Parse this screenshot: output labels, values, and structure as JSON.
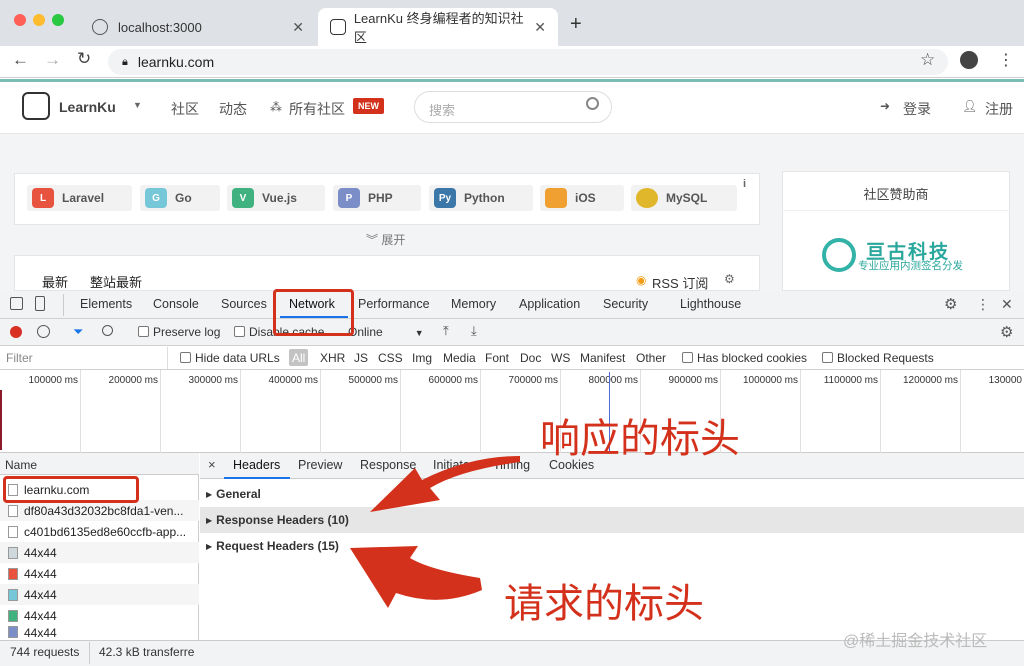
{
  "browser": {
    "tabs": [
      {
        "title": "localhost:3000"
      },
      {
        "title": "LearnKu 终身编程者的知识社区"
      }
    ],
    "new_tab": "+",
    "url": "learnku.com"
  },
  "site": {
    "logo_text": "LearnKu",
    "nav": [
      "社区",
      "动态",
      "所有社区"
    ],
    "new_badge": "NEW",
    "search_placeholder": "搜索",
    "login": "登录",
    "register": "注册",
    "categories": [
      "Laravel",
      "Go",
      "Vue.js",
      "PHP",
      "Python",
      "iOS",
      "MySQL"
    ],
    "expand": "展开",
    "feed_tabs": [
      "最新",
      "整站最新"
    ],
    "rss": "RSS 订阅",
    "sponsor_title": "社区赞助商",
    "sponsor_name": "亘古科技",
    "sponsor_slogan": "专业应用内测签名分发"
  },
  "devtools": {
    "tabs": [
      "Elements",
      "Console",
      "Sources",
      "Network",
      "Performance",
      "Memory",
      "Application",
      "Security",
      "Lighthouse"
    ],
    "active_tab": "Network",
    "preserve_log": "Preserve log",
    "disable_cache": "Disable cache",
    "throttle": "Online",
    "filter_placeholder": "Filter",
    "hide_data_urls": "Hide data URLs",
    "types": [
      "All",
      "XHR",
      "JS",
      "CSS",
      "Img",
      "Media",
      "Font",
      "Doc",
      "WS",
      "Manifest",
      "Other"
    ],
    "has_blocked_cookies": "Has blocked cookies",
    "blocked_requests": "Blocked Requests",
    "timeline_ticks": [
      "100000 ms",
      "200000 ms",
      "300000 ms",
      "400000 ms",
      "500000 ms",
      "600000 ms",
      "700000 ms",
      "800000 ms",
      "900000 ms",
      "1000000 ms",
      "1100000 ms",
      "1200000 ms",
      "130000"
    ],
    "name_header": "Name",
    "requests": [
      "learnku.com",
      "df80a43d32032bc8fda1-ven...",
      "c401bd6135ed8e60ccfb-app...",
      "44x44",
      "44x44",
      "44x44",
      "44x44",
      "44x44"
    ],
    "status": {
      "requests": "744 requests",
      "transferred": "42.3 kB transferre"
    },
    "detail_close": "×",
    "detail_tabs": [
      "Headers",
      "Preview",
      "Response",
      "Initiator",
      "Timing",
      "Cookies"
    ],
    "sections": [
      "General",
      "Response Headers (10)",
      "Request Headers (15)"
    ]
  },
  "annotations": {
    "response_label": "响应的标头",
    "request_label": "请求的标头",
    "watermark": "@稀土掘金技术社区"
  },
  "colors": {
    "accent_red": "#d3311c",
    "devtools_blue": "#1a73e8",
    "site_teal": "#79bcb6"
  }
}
